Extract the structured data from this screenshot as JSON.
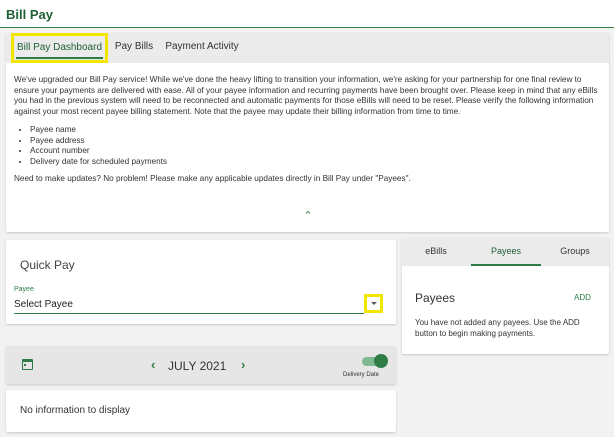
{
  "header": {
    "title": "Bill Pay"
  },
  "tabs": {
    "dashboard": "Bill Pay Dashboard",
    "pay_bills": "Pay Bills",
    "payment_activity": "Payment Activity"
  },
  "notice": {
    "intro": "We've upgraded our Bill Pay service! While we've done the heavy lifting to transition your information, we're asking for your partnership for one final review to ensure your payments are delivered with ease. All of your payee information and recurring payments have been brought over. Please keep in mind that any eBills you had in the previous system will need to be reconnected and automatic payments for those eBills will need to be reset. Please verify the following information against your most recent payee billing statement. Note that the payee may update their billing information from time to time.",
    "items": [
      "Payee name",
      "Payee address",
      "Account number",
      "Delivery date for scheduled payments"
    ],
    "footer": "Need to make updates? No problem! Please make any applicable updates directly in Bill Pay under \"Payees\".",
    "collapse_icon": "chevron-up-icon"
  },
  "quick_pay": {
    "title": "Quick Pay",
    "payee_label": "Payee",
    "payee_value": "Select Payee"
  },
  "calendar": {
    "month": "JULY 2021",
    "toggle_label": "Delivery Date",
    "toggle_on": true
  },
  "empty": {
    "text": "No information to display"
  },
  "right_panel": {
    "tabs": {
      "ebills": "eBills",
      "payees": "Payees",
      "groups": "Groups"
    },
    "title": "Payees",
    "add": "ADD",
    "message": "You have not added any payees. Use the ADD button to begin making payments."
  },
  "colors": {
    "accent": "#2e7d45",
    "highlight": "#f2e600"
  }
}
